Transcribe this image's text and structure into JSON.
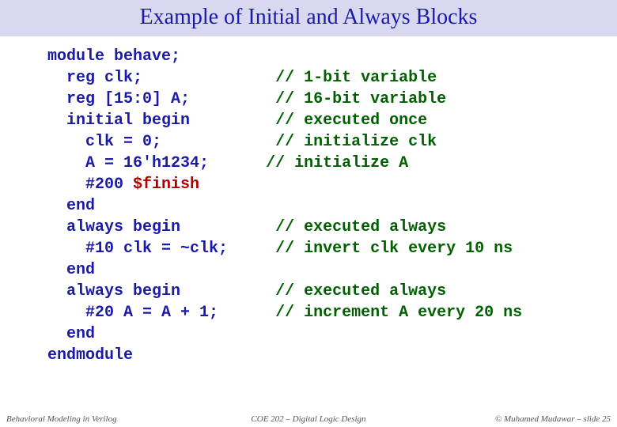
{
  "title": "Example of Initial and Always Blocks",
  "code": {
    "l1": {
      "t": "module behave;",
      "pad": 0
    },
    "l2": {
      "t": "  reg clk;",
      "pad": 14,
      "c": "// 1-bit variable"
    },
    "l3": {
      "t": "  reg [15:0] A;",
      "pad": 9,
      "c": "// 16-bit variable"
    },
    "l4": {
      "t": "  initial begin",
      "pad": 9,
      "c": "// executed once"
    },
    "l5": {
      "t": "    clk = 0;",
      "pad": 12,
      "c": "// initialize clk"
    },
    "l6": {
      "t": "    A = 16'h1234;",
      "pad": 6,
      "c": "// initialize A"
    },
    "l7a": {
      "t": "    #200 "
    },
    "l7b": {
      "t": "$finish"
    },
    "l8": {
      "t": "  end",
      "pad": 0
    },
    "l9": {
      "t": "  always begin",
      "pad": 10,
      "c": "// executed always"
    },
    "l10": {
      "t": "    #10 clk = ~clk;",
      "pad": 5,
      "c": "// invert clk every 10 ns"
    },
    "l11": {
      "t": "  end",
      "pad": 0
    },
    "l12": {
      "t": "  always begin",
      "pad": 10,
      "c": "// executed always"
    },
    "l13": {
      "t": "    #20 A = A + 1;",
      "pad": 6,
      "c": "// increment A every 20 ns"
    },
    "l14": {
      "t": "  end",
      "pad": 0
    },
    "l15": {
      "t": "endmodule",
      "pad": 0
    }
  },
  "footer": {
    "left": "Behavioral Modeling in Verilog",
    "mid": "COE 202 – Digital Logic Design",
    "right": "© Muhamed Mudawar – slide 25"
  }
}
